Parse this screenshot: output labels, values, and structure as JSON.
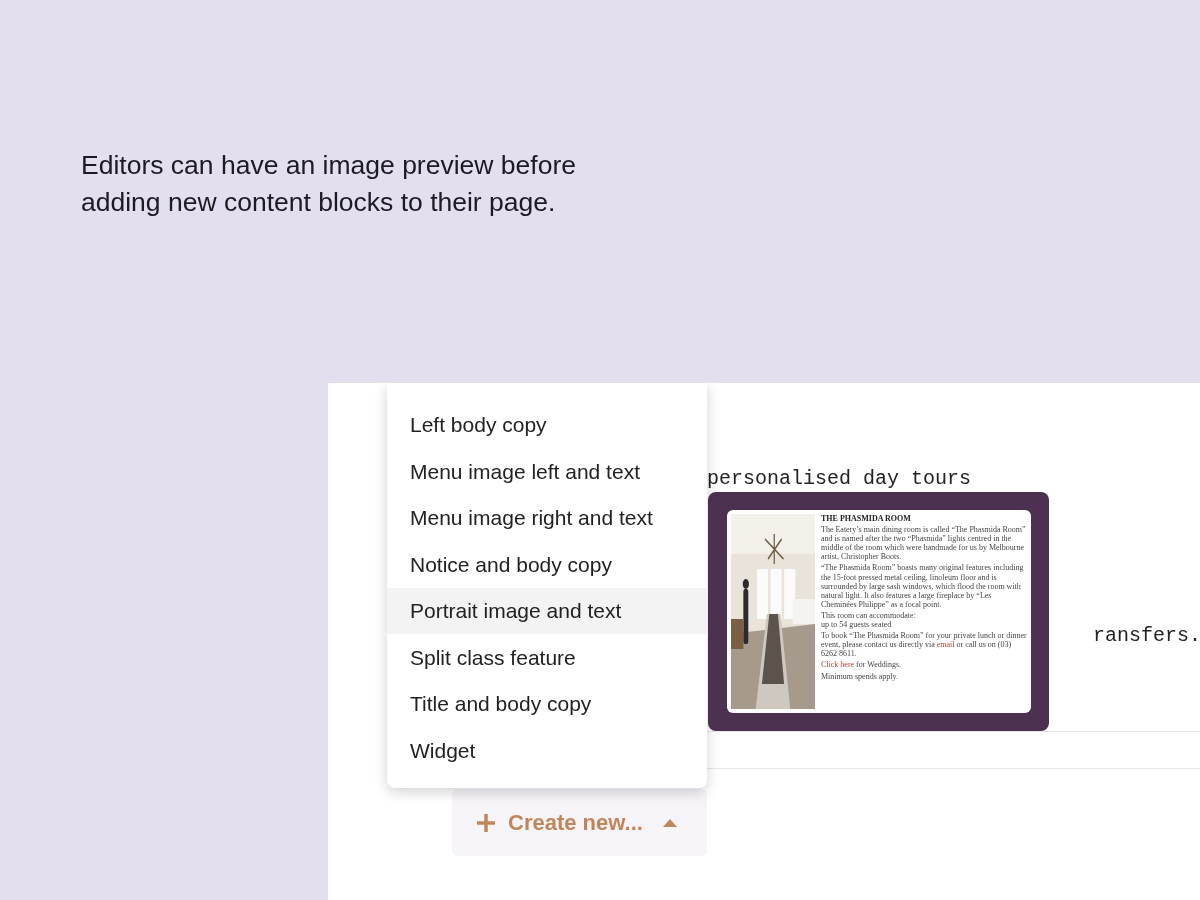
{
  "headline": "Editors can have an image preview before adding new content blocks to their page.",
  "background_text": [
    "personalised day tours",
    "ransfers."
  ],
  "menu": {
    "items": [
      {
        "label": "Left body copy",
        "selected": false
      },
      {
        "label": "Menu image left and text",
        "selected": false
      },
      {
        "label": "Menu image right and text",
        "selected": false
      },
      {
        "label": "Notice and body copy",
        "selected": false
      },
      {
        "label": "Portrait image and text",
        "selected": true
      },
      {
        "label": "Split class feature",
        "selected": false
      },
      {
        "label": "Title and body copy",
        "selected": false
      },
      {
        "label": "Widget",
        "selected": false
      }
    ]
  },
  "preview": {
    "image": {
      "kind": "picture"
    },
    "title": "THE PHASMIDA ROOM",
    "paragraphs": [
      [
        {
          "kind": "text",
          "text": "The Eatery’s main dining room is called “The Phasmida Room” and is named after the two “Phasmida” lights centred in the middle of the room which were handmade for us by Melbourne artist, Christopher Boots."
        }
      ],
      [
        {
          "kind": "text",
          "text": "“The Phasmida Room” boasts many original features including the 15-foot pressed metal ceiling, linoleum floor and is surrounded by large sash windows, which flood the room with natural light. It also features a large fireplace by “Les Cheminées Philippe” as a focal point."
        }
      ],
      [
        {
          "kind": "text",
          "text": "This room can accommodate:"
        },
        {
          "kind": "break"
        },
        {
          "kind": "text",
          "text": "up to 54 guests seated"
        }
      ],
      [
        {
          "kind": "text",
          "text": "To book “The Phasmida Room” for your private lunch or dinner event, please contact us directly via "
        },
        {
          "kind": "link",
          "text": "email"
        },
        {
          "kind": "text",
          "text": " or call us on (03) 6262 8611."
        }
      ],
      [
        {
          "kind": "link",
          "text": "Click here"
        },
        {
          "kind": "text",
          "text": " for Weddings."
        }
      ],
      [
        {
          "kind": "text",
          "text": "Minimum spends apply."
        }
      ]
    ]
  },
  "create_button": {
    "label": "Create new...",
    "expanded": true
  }
}
